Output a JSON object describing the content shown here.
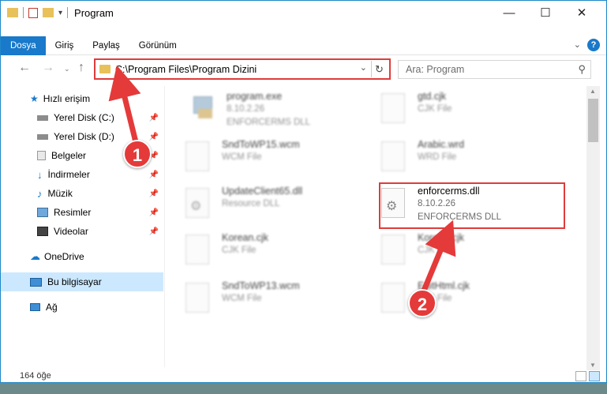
{
  "window": {
    "title": "Program"
  },
  "window_controls": {
    "minimize": "—",
    "maximize": "☐",
    "close": "✕"
  },
  "ribbon": {
    "tabs": [
      {
        "label": "Dosya",
        "active": true
      },
      {
        "label": "Giriş"
      },
      {
        "label": "Paylaş"
      },
      {
        "label": "Görünüm"
      }
    ],
    "help": "?"
  },
  "address": {
    "path": "C:\\Program Files\\Program Dizini"
  },
  "search": {
    "placeholder": "Ara: Program"
  },
  "sidebar": {
    "items": [
      {
        "label": "Hızlı erişim",
        "icon": "star-icon",
        "pinned": false
      },
      {
        "label": "Yerel Disk (C:)",
        "icon": "drive-icon",
        "pinned": true
      },
      {
        "label": "Yerel Disk (D:)",
        "icon": "drive-icon",
        "pinned": true
      },
      {
        "label": "Belgeler",
        "icon": "documents-icon",
        "pinned": true
      },
      {
        "label": "İndirmeler",
        "icon": "download-icon",
        "pinned": true
      },
      {
        "label": "Müzik",
        "icon": "music-icon",
        "pinned": true
      },
      {
        "label": "Resimler",
        "icon": "pictures-icon",
        "pinned": true
      },
      {
        "label": "Videolar",
        "icon": "video-icon",
        "pinned": true
      },
      {
        "label": "OneDrive",
        "icon": "cloud-icon",
        "pinned": false
      },
      {
        "label": "Bu bilgisayar",
        "icon": "computer-icon",
        "pinned": false,
        "selected": true
      },
      {
        "label": "Ağ",
        "icon": "network-icon",
        "pinned": false
      }
    ]
  },
  "files": [
    {
      "name": "program.exe",
      "line2": "8.10.2.26",
      "line3": "ENFORCERMS DLL"
    },
    {
      "name": "gtd.cjk",
      "line2": "CJK File"
    },
    {
      "name": "SndToWP15.wcm",
      "line2": "WCM File"
    },
    {
      "name": "Arabic.wrd",
      "line2": "WRD File"
    },
    {
      "name": "UpdateClient65.dll",
      "line2": "Resource DLL"
    },
    {
      "name": "enforcerms.dll",
      "line2": "8.10.2.26",
      "line3": "ENFORCERMS DLL"
    },
    {
      "name": "Korean.cjk",
      "line2": "CJK File"
    },
    {
      "name": "Korean.cjk",
      "line2": "CJK File"
    },
    {
      "name": "SndToWP13.wcm",
      "line2": "WCM File"
    },
    {
      "name": "EditHtml.cjk",
      "line2": "CJK File"
    }
  ],
  "status": {
    "count": "164 öğe"
  },
  "annotations": {
    "one": "1",
    "two": "2"
  },
  "colors": {
    "accent": "#1979ca",
    "highlight": "#e03b3b",
    "selected": "#cce8ff"
  }
}
